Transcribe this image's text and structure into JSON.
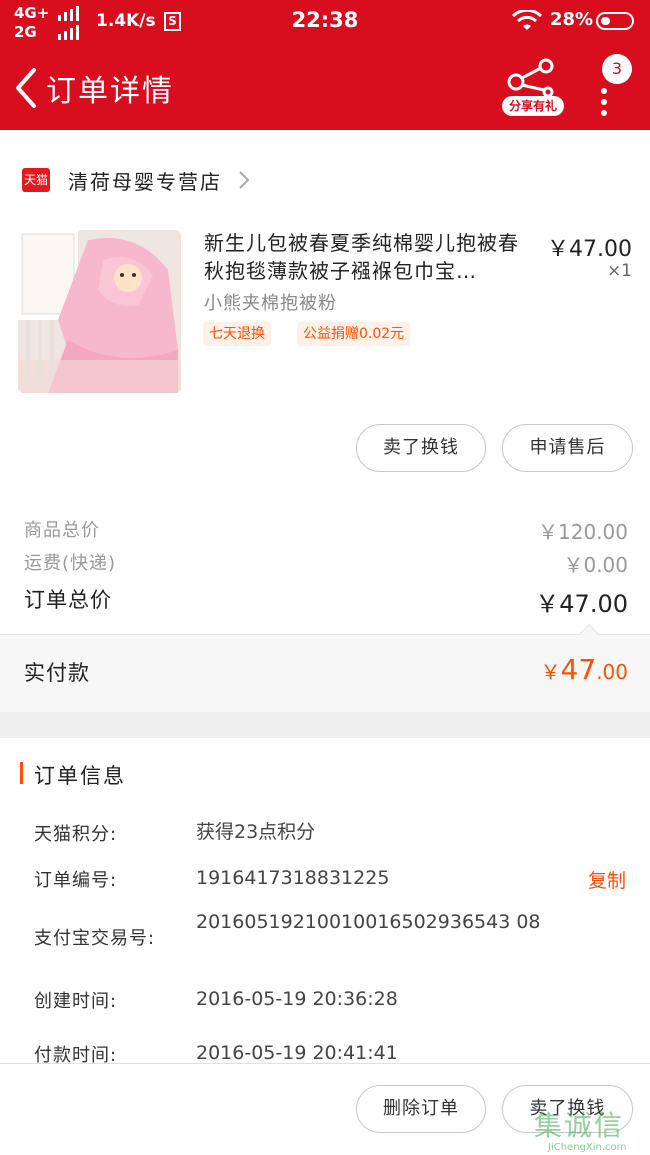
{
  "status_bar": {
    "network_top": "4G+",
    "network_bottom": "2G",
    "speed": "1.4K/s",
    "s_icon": "S",
    "time": "22:38",
    "battery": "28%"
  },
  "nav": {
    "title": "订单详情",
    "share_label": "分享有礼",
    "badge_count": "3"
  },
  "store": {
    "badge": "天猫",
    "name": "清荷母婴专营店"
  },
  "product": {
    "title": "新生儿包被春夏季纯棉婴儿抱被春秋抱毯薄款被子襁褓包巾宝…",
    "price": "￥47.00",
    "quantity": "×1",
    "spec": "小熊夹棉抱被粉",
    "tags": [
      "七天退换",
      "公益捐赠0.02元"
    ]
  },
  "actions_top": {
    "sell": "卖了换钱",
    "after_sale": "申请售后"
  },
  "summary": {
    "goods_total_label": "商品总价",
    "goods_total_value": "￥120.00",
    "shipping_label": "运费(快递)",
    "shipping_value": "￥0.00",
    "order_total_label": "订单总价",
    "order_total_value": "￥47.00",
    "paid_label": "实付款",
    "paid_currency": "￥",
    "paid_integer": "47",
    "paid_decimal": ".00"
  },
  "order_info": {
    "title": "订单信息",
    "points_label": "天猫积分:",
    "points_value": "获得23点积分",
    "order_no_label": "订单编号:",
    "order_no_value": "1916417318831225",
    "copy_label": "复制",
    "alipay_label": "支付宝交易号:",
    "alipay_value": "20160519210010016502936543 08",
    "created_label": "创建时间:",
    "created_value": "2016-05-19 20:36:28",
    "paid_time_label": "付款时间:",
    "paid_time_value": "2016-05-19 20:41:41"
  },
  "bottom": {
    "delete": "删除订单",
    "sell": "卖了换钱"
  },
  "watermark": {
    "main": "集诚信",
    "sub": "JiChengXin.com"
  },
  "colors": {
    "brand_red": "#d80d1e",
    "accent_orange": "#ff5000"
  }
}
